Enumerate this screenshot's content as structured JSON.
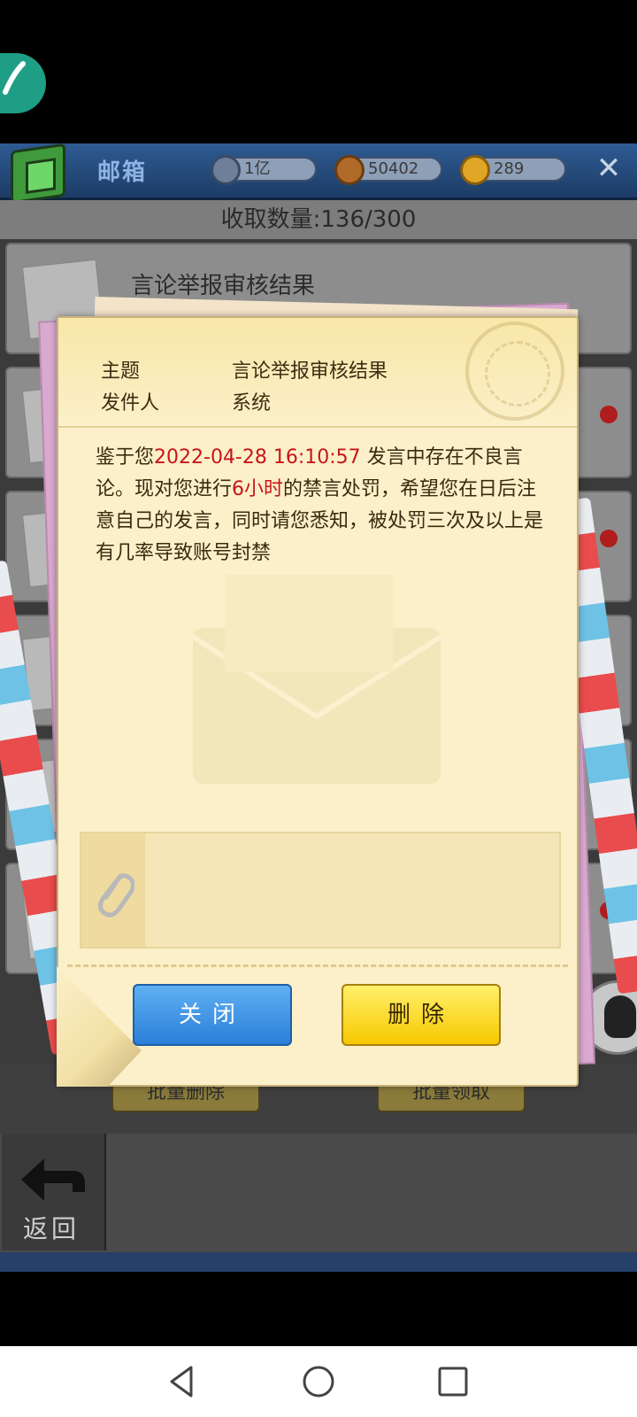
{
  "header": {
    "title": "邮箱",
    "resources": [
      {
        "icon": "diamond-coin-icon",
        "value": "1亿"
      },
      {
        "icon": "medal-icon",
        "value": "50402"
      },
      {
        "icon": "gold-coin-icon",
        "value": "289"
      }
    ],
    "close_label": "✕"
  },
  "mail_count": "收取数量:136/300",
  "mail_list": {
    "first_subject": "言论举报审核结果"
  },
  "list_buttons": {
    "batch_delete": "批量删除",
    "batch_claim": "批量领取"
  },
  "back_label": "返回",
  "modal": {
    "subject_label": "主题",
    "subject_value": "言论举报审核结果",
    "sender_label": "发件人",
    "sender_value": "系统",
    "body_prefix": "鉴于您",
    "body_datetime": "2022-04-28 16:10:57",
    "body_mid1": " 发言中存在不良言论。现对您进行",
    "body_duration": "6小时",
    "body_rest": "的禁言处罚，希望您在日后注意自己的发言，同时请您悉知，被处罚三次及以上是有几率导致账号封禁",
    "close_button": "关闭",
    "delete_button": "删除"
  },
  "colors": {
    "highlight_red": "#c9141b",
    "close_blue": "#2a7fd8",
    "delete_yellow": "#f7c800"
  },
  "navbar": {
    "back_icon": "triangle-back-icon",
    "home_icon": "circle-home-icon",
    "recents_icon": "square-recents-icon"
  }
}
